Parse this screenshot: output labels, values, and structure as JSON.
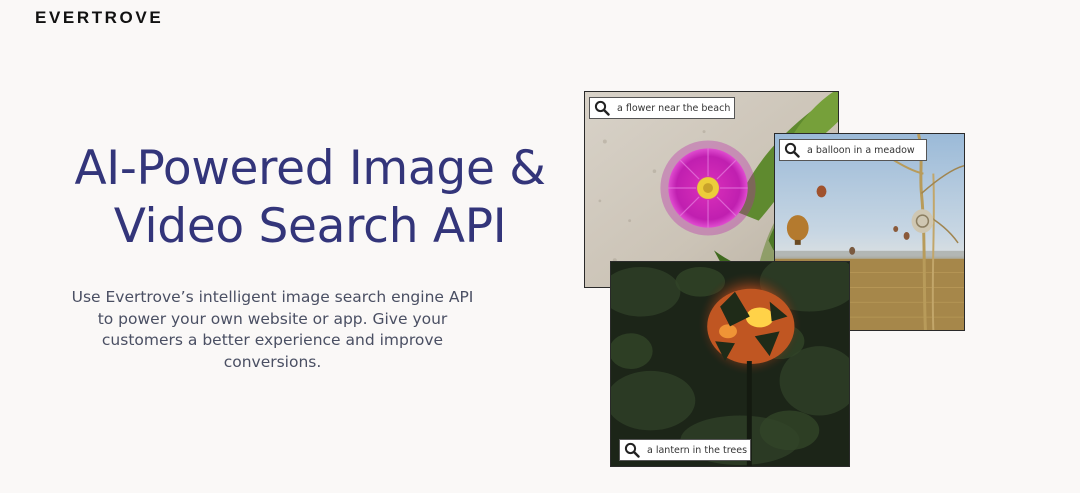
{
  "brand": {
    "logo_text": "EVERTROVE"
  },
  "hero": {
    "title": "AI-Powered Image & Video Search API",
    "description": "Use Evertrove’s intelligent image search engine API to power your own website or app. Give your customers a better experience and improve conversions."
  },
  "examples": [
    {
      "query": "a flower near the beach",
      "icon": "search-icon"
    },
    {
      "query": "a balloon in a meadow",
      "icon": "search-icon"
    },
    {
      "query": "a lantern in the trees",
      "icon": "search-icon"
    }
  ],
  "colors": {
    "background": "#faf8f7",
    "title": "#33357a",
    "body_text": "#4a4f63",
    "logo": "#111111"
  }
}
